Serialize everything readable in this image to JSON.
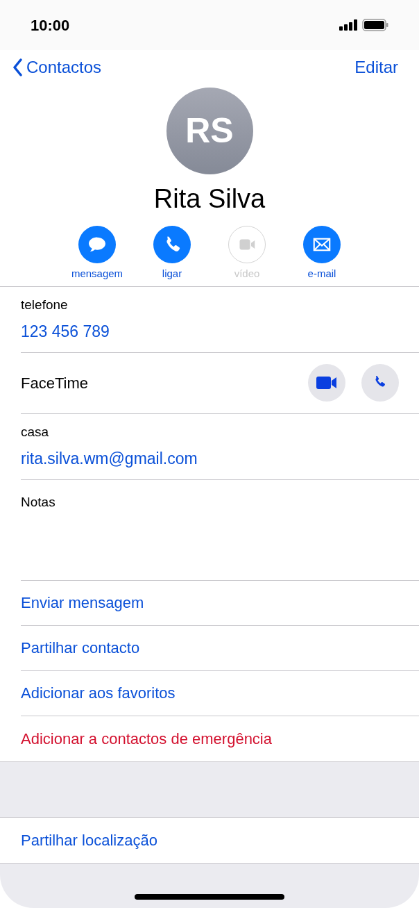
{
  "status_bar": {
    "time": "10:00"
  },
  "nav": {
    "back": "Contactos",
    "edit": "Editar"
  },
  "contact": {
    "initials": "RS",
    "name": "Rita Silva"
  },
  "quick_actions": [
    {
      "kind": "message",
      "label": "mensagem",
      "disabled": false
    },
    {
      "kind": "call",
      "label": "ligar",
      "disabled": false
    },
    {
      "kind": "video",
      "label": "vídeo",
      "disabled": true
    },
    {
      "kind": "mail",
      "label": "e-mail",
      "disabled": false
    }
  ],
  "fields": [
    {
      "kind": "value",
      "label": "telefone",
      "value": "123 456 789"
    },
    {
      "kind": "facetime",
      "label": "FaceTime"
    },
    {
      "kind": "value",
      "label": "casa",
      "value": "rita.silva.wm@gmail.com"
    },
    {
      "kind": "notes",
      "label": "Notas"
    }
  ],
  "actions": [
    {
      "label": "Enviar mensagem",
      "destructive": false
    },
    {
      "label": "Partilhar contacto",
      "destructive": false
    },
    {
      "label": "Adicionar aos favoritos",
      "destructive": false
    },
    {
      "label": "Adicionar a contactos de emergência",
      "destructive": true
    }
  ],
  "extra_actions": [
    {
      "label": "Partilhar localização",
      "destructive": false
    }
  ]
}
